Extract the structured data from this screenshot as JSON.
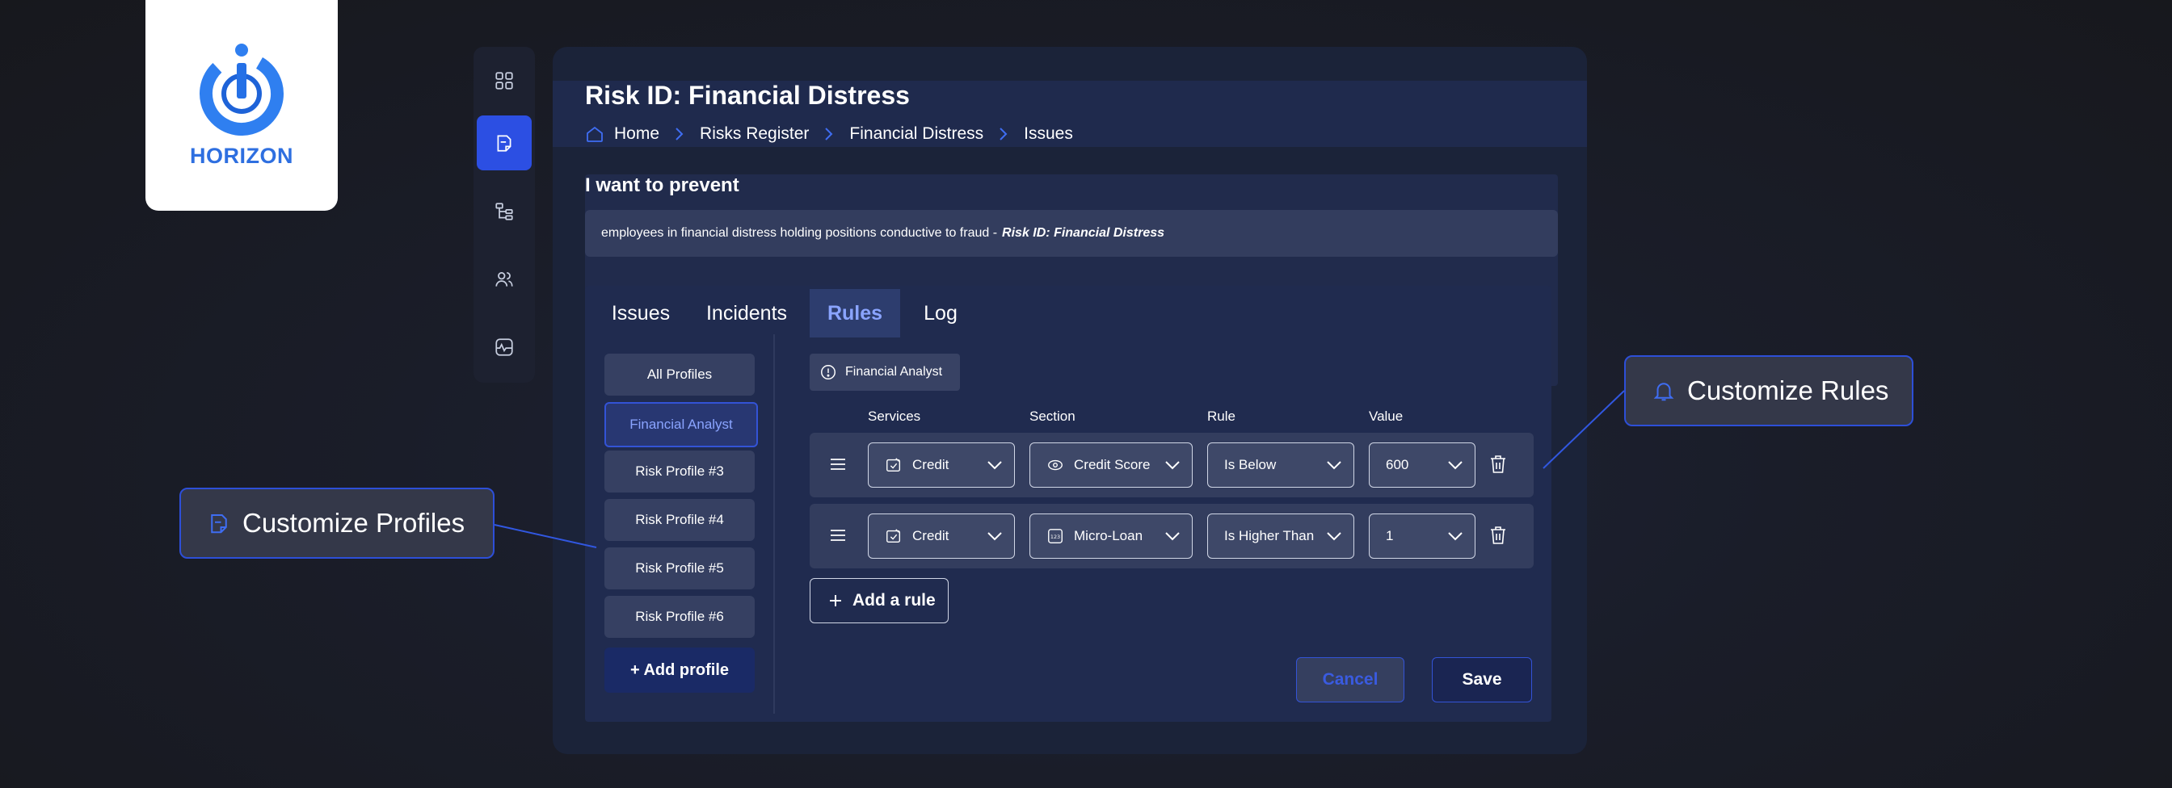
{
  "brand": {
    "name": "HORIZON",
    "color": "#2e6fe0"
  },
  "nav_icons": [
    "dashboard-icon",
    "document-icon",
    "hierarchy-icon",
    "users-icon",
    "monitor-icon"
  ],
  "page": {
    "title": "Risk ID: Financial Distress"
  },
  "breadcrumb": [
    "Home",
    "Risks Register",
    "Financial Distress",
    "Issues"
  ],
  "prevent": {
    "heading": "I want to prevent",
    "text": "employees in financial distress holding positions conductive to fraud -",
    "emphasis": "Risk ID: Financial Distress"
  },
  "tabs": [
    {
      "label": "Issues",
      "active": false
    },
    {
      "label": "Incidents",
      "active": false
    },
    {
      "label": "Rules",
      "active": true
    },
    {
      "label": "Log",
      "active": false
    }
  ],
  "profiles": [
    "All Profiles",
    "Financial Analyst",
    "Risk Profile #3",
    "Risk Profile #4",
    "Risk Profile #5",
    "Risk Profile #6"
  ],
  "selected_profile": "Financial Analyst",
  "add_profile_label": "+ Add profile",
  "role_chip": "Financial Analyst",
  "columns": [
    "Services",
    "Section",
    "Rule",
    "Value"
  ],
  "rules": [
    {
      "service": "Credit",
      "section": "Credit Score",
      "rule": "Is Below",
      "value": "600"
    },
    {
      "service": "Credit",
      "section": "Micro-Loan",
      "rule": "Is Higher Than",
      "value": "1"
    }
  ],
  "add_rule_label": "Add a rule",
  "buttons": {
    "cancel": "Cancel",
    "save": "Save"
  },
  "callouts": {
    "profiles": "Customize Profiles",
    "rules": "Customize Rules"
  },
  "colors": {
    "accent": "#2c4fe3",
    "active_tab_text": "#8aa4ff",
    "panel": "#1b2339"
  }
}
